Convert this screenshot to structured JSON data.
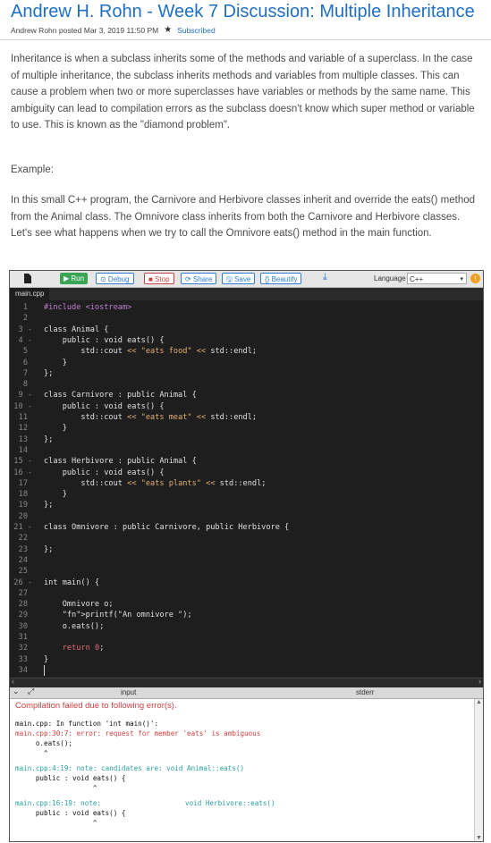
{
  "post": {
    "title": "Andrew H. Rohn - Week 7 Discussion: Multiple Inheritance",
    "meta": "Andrew Rohn posted Mar 3, 2019 11:50 PM",
    "subscribed": "Subscribed",
    "paragraph1": "Inheritance is when a subclass inherits some of the methods and variable of a superclass. In the case of multiple inheritance, the subclass inherits methods and variables from multiple classes. This can cause a problem when two or more superclasses have variables or methods by the same name. This ambiguity can lead to compilation errors as the subclass doesn't know which super method or variable to use. This is known as the \"diamond problem\".",
    "paragraph2": "Example:",
    "paragraph3": "In this small C++ program, the Carnivore and Herbivore classes inherit and override the eats() method from the Animal class. The Omnivore class inherits from both the Carnivore and Herbivore classes. Let's see what happens when we try to call the Omnivore eats() method in the main function."
  },
  "ide": {
    "toolbar": {
      "run": "▶ Run",
      "debug": "⊙ Debug",
      "stop": "■ Stop",
      "share": "⟳ Share",
      "save": "🖫 Save",
      "beautify": "{} Beautify",
      "language_label": "Language",
      "language_value": "C++"
    },
    "file_tab": "main.cpp",
    "code_lines": [
      {
        "n": "1",
        "fold": "",
        "text": "#include <iostream>",
        "cls": "inc"
      },
      {
        "n": "2",
        "fold": "",
        "text": "",
        "cls": ""
      },
      {
        "n": "3",
        "fold": "-",
        "text": "class Animal {",
        "cls": ""
      },
      {
        "n": "4",
        "fold": "-",
        "text": "    public : void eats() {",
        "cls": ""
      },
      {
        "n": "5",
        "fold": "",
        "text": "        std::cout << \"eats food\" << std::endl;",
        "cls": "mix"
      },
      {
        "n": "6",
        "fold": "",
        "text": "    }",
        "cls": ""
      },
      {
        "n": "7",
        "fold": "",
        "text": "};",
        "cls": ""
      },
      {
        "n": "8",
        "fold": "",
        "text": "",
        "cls": ""
      },
      {
        "n": "9",
        "fold": "-",
        "text": "class Carnivore : public Animal {",
        "cls": ""
      },
      {
        "n": "10",
        "fold": "-",
        "text": "    public : void eats() {",
        "cls": ""
      },
      {
        "n": "11",
        "fold": "",
        "text": "        std::cout << \"eats meat\" << std::endl;",
        "cls": "mix"
      },
      {
        "n": "12",
        "fold": "",
        "text": "    }",
        "cls": ""
      },
      {
        "n": "13",
        "fold": "",
        "text": "};",
        "cls": ""
      },
      {
        "n": "14",
        "fold": "",
        "text": "",
        "cls": ""
      },
      {
        "n": "15",
        "fold": "-",
        "text": "class Herbivore : public Animal {",
        "cls": ""
      },
      {
        "n": "16",
        "fold": "-",
        "text": "    public : void eats() {",
        "cls": ""
      },
      {
        "n": "17",
        "fold": "",
        "text": "        std::cout << \"eats plants\" << std::endl;",
        "cls": "mix"
      },
      {
        "n": "18",
        "fold": "",
        "text": "    }",
        "cls": ""
      },
      {
        "n": "19",
        "fold": "",
        "text": "};",
        "cls": ""
      },
      {
        "n": "20",
        "fold": "",
        "text": "",
        "cls": ""
      },
      {
        "n": "21",
        "fold": "-",
        "text": "class Omnivore : public Carnivore, public Herbivore {",
        "cls": ""
      },
      {
        "n": "22",
        "fold": "",
        "text": "",
        "cls": ""
      },
      {
        "n": "23",
        "fold": "",
        "text": "};",
        "cls": ""
      },
      {
        "n": "24",
        "fold": "",
        "text": "",
        "cls": ""
      },
      {
        "n": "25",
        "fold": "",
        "text": "",
        "cls": ""
      },
      {
        "n": "26",
        "fold": "-",
        "text": "int main() {",
        "cls": ""
      },
      {
        "n": "27",
        "fold": "",
        "text": "",
        "cls": ""
      },
      {
        "n": "28",
        "fold": "",
        "text": "    Omnivore o;",
        "cls": ""
      },
      {
        "n": "29",
        "fold": "",
        "text": "    printf(\"An omnivore \");",
        "cls": "printf"
      },
      {
        "n": "30",
        "fold": "",
        "text": "    o.eats();",
        "cls": ""
      },
      {
        "n": "31",
        "fold": "",
        "text": "",
        "cls": ""
      },
      {
        "n": "32",
        "fold": "",
        "text": "    return 0;",
        "cls": "return"
      },
      {
        "n": "33",
        "fold": "",
        "text": "}",
        "cls": ""
      },
      {
        "n": "34",
        "fold": "",
        "text": "",
        "cls": ""
      }
    ],
    "output_tabs": {
      "input": "input",
      "stderr": "stderr"
    },
    "output": {
      "header": "Compilation failed due to following error(s).",
      "l1": "main.cpp: In function 'int main()':",
      "l2_loc": "main.cpp:30:7:",
      "l2_rest": " error: request for member 'eats' is ambiguous",
      "l3": "     o.eats();",
      "l4": "       ^",
      "l5_loc": "main.cpp:4:19:",
      "l5_rest": " note: candidates are: void Animal::eats()",
      "l6": "     public : void eats() {",
      "l7": "                   ^",
      "l8_loc": "main.cpp:16:19:",
      "l8_rest": " note:",
      "l8_right": "void Herbivore::eats()",
      "l9": "     public : void eats() {",
      "l10": "                   ^"
    }
  }
}
